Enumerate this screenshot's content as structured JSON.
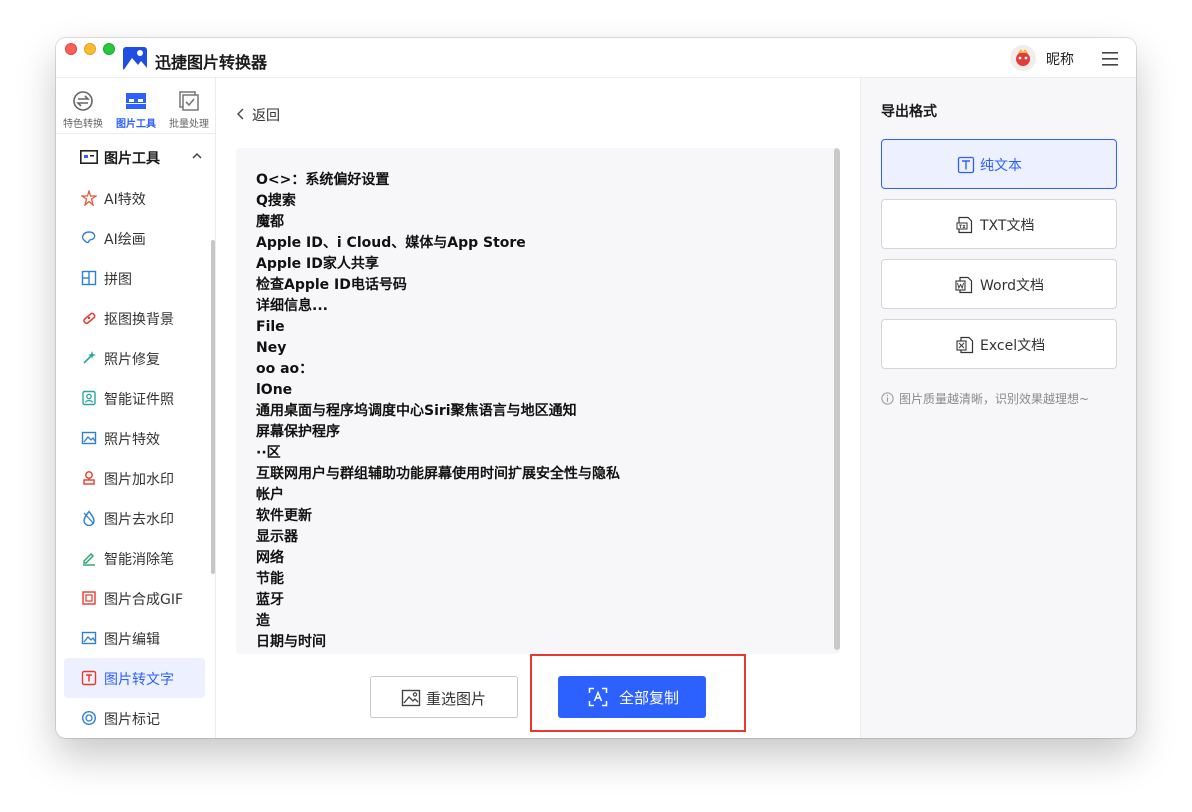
{
  "app": {
    "title": "迅捷图片转换器",
    "user_name": "昵称"
  },
  "top_tabs": [
    {
      "label": "特色转换",
      "icon": "convert-icon"
    },
    {
      "label": "图片工具",
      "icon": "image-tools-icon",
      "active": true
    },
    {
      "label": "批量处理",
      "icon": "batch-icon"
    }
  ],
  "sidebar": {
    "group_label": "图片工具",
    "items": [
      {
        "label": "AI特效",
        "icon": "ai-effect-icon"
      },
      {
        "label": "AI绘画",
        "icon": "ai-paint-icon"
      },
      {
        "label": "拼图",
        "icon": "collage-icon"
      },
      {
        "label": "抠图换背景",
        "icon": "cutout-icon"
      },
      {
        "label": "照片修复",
        "icon": "photo-repair-icon"
      },
      {
        "label": "智能证件照",
        "icon": "id-photo-icon"
      },
      {
        "label": "照片特效",
        "icon": "photo-effect-icon"
      },
      {
        "label": "图片加水印",
        "icon": "add-watermark-icon"
      },
      {
        "label": "图片去水印",
        "icon": "remove-watermark-icon"
      },
      {
        "label": "智能消除笔",
        "icon": "eraser-pen-icon"
      },
      {
        "label": "图片合成GIF",
        "icon": "gif-icon"
      },
      {
        "label": "图片编辑",
        "icon": "image-edit-icon"
      },
      {
        "label": "图片转文字",
        "icon": "image-to-text-icon",
        "active": true
      },
      {
        "label": "图片标记",
        "icon": "image-mark-icon"
      }
    ]
  },
  "main": {
    "back_label": "返回",
    "ocr_lines": [
      "O<>：系统偏好设置",
      "Q搜索",
      "魔都",
      "Apple ID、i Cloud、媒体与App Store",
      "Apple ID家人共享",
      "检查Apple ID电话号码",
      "详细信息...",
      "File",
      "Ney",
      "oo ao：",
      "lOne",
      "通用桌面与程序坞调度中心Siri聚焦语言与地区通知",
      "屏幕保护程序",
      "··区",
      "互联网用户与群组辅助功能屏幕使用时间扩展安全性与隐私",
      "帐户",
      "软件更新",
      "显示器",
      "网络",
      "节能",
      "蓝牙",
      "造",
      "日期与时间"
    ],
    "reselect_label": "重选图片",
    "copy_all_label": "全部复制"
  },
  "export": {
    "title": "导出格式",
    "formats": [
      {
        "label": "纯文本",
        "icon": "plain-text-icon",
        "active": true
      },
      {
        "label": "TXT文档",
        "icon": "txt-doc-icon"
      },
      {
        "label": "Word文档",
        "icon": "word-doc-icon"
      },
      {
        "label": "Excel文档",
        "icon": "excel-doc-icon"
      }
    ],
    "tip": "图片质量越清晰，识别效果越理想~"
  },
  "colors": {
    "accent": "#2d61ff",
    "highlight": "#e8392e"
  }
}
